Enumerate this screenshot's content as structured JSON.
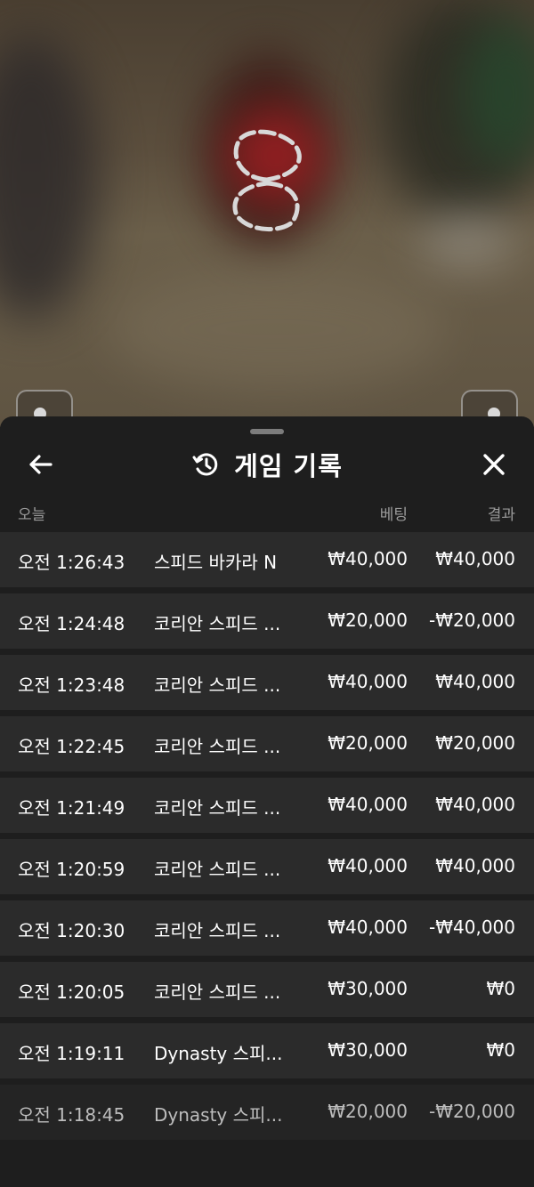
{
  "panel": {
    "title": "게임 기록",
    "back_icon": "arrow-left-icon",
    "history_icon": "history-icon",
    "close_icon": "close-icon"
  },
  "columns": {
    "date": "오늘",
    "bet": "베팅",
    "result": "결과"
  },
  "rows": [
    {
      "time": "오전 1:26:43",
      "game": "스피드 바카라 N",
      "bet": "₩40,000",
      "result": "₩40,000"
    },
    {
      "time": "오전 1:24:48",
      "game": "코리안 스피드 ...",
      "bet": "₩20,000",
      "result": "-₩20,000"
    },
    {
      "time": "오전 1:23:48",
      "game": "코리안 스피드 ...",
      "bet": "₩40,000",
      "result": "₩40,000"
    },
    {
      "time": "오전 1:22:45",
      "game": "코리안 스피드 ...",
      "bet": "₩20,000",
      "result": "₩20,000"
    },
    {
      "time": "오전 1:21:49",
      "game": "코리안 스피드 ...",
      "bet": "₩40,000",
      "result": "₩40,000"
    },
    {
      "time": "오전 1:20:59",
      "game": "코리안 스피드 ...",
      "bet": "₩40,000",
      "result": "₩40,000"
    },
    {
      "time": "오전 1:20:30",
      "game": "코리안 스피드 ...",
      "bet": "₩40,000",
      "result": "-₩40,000"
    },
    {
      "time": "오전 1:20:05",
      "game": "코리안 스피드 ...",
      "bet": "₩30,000",
      "result": "₩0"
    },
    {
      "time": "오전 1:19:11",
      "game": "Dynasty 스피...",
      "bet": "₩30,000",
      "result": "₩0"
    },
    {
      "time": "오전 1:18:45",
      "game": "Dynasty 스피...",
      "bet": "₩20,000",
      "result": "-₩20,000"
    }
  ],
  "colors": {
    "panel_bg": "#1e1e1e",
    "row_bg": "#2b2b2b",
    "text": "#ffffff",
    "muted": "#9a9a9a"
  }
}
